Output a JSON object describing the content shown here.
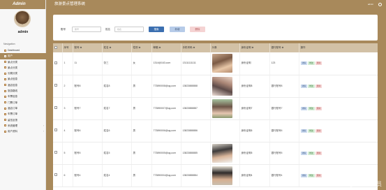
{
  "app": {
    "brand": "Admin",
    "title": "旅游景点管理系统",
    "user_top": "admin",
    "sidebar_user": "admin"
  },
  "sidebar": {
    "section_title": "Navigation",
    "items": [
      {
        "label": "Dashboard",
        "active": false
      },
      {
        "label": "用户",
        "active": true
      },
      {
        "label": "景点分类",
        "active": false
      },
      {
        "label": "景点分类",
        "active": false
      },
      {
        "label": "长期分类",
        "active": false
      },
      {
        "label": "景点信息",
        "active": false
      },
      {
        "label": "酒店信息",
        "active": false
      },
      {
        "label": "旅游路线",
        "active": false
      },
      {
        "label": "车票信息",
        "active": false
      },
      {
        "label": "门票订单",
        "active": false
      },
      {
        "label": "酒店订单",
        "active": false
      },
      {
        "label": "车票订单",
        "active": false
      },
      {
        "label": "留言反馈",
        "active": false
      },
      {
        "label": "系统管理",
        "active": false,
        "chevron": true
      },
      {
        "label": "用户资料",
        "active": false,
        "chevron": true
      }
    ]
  },
  "search": {
    "account_label": "账号",
    "account_placeholder": "账号",
    "name_label": "姓名",
    "name_placeholder": "姓名",
    "search_button": "搜索",
    "add_button": "新增",
    "delete_button": "删除"
  },
  "table": {
    "headers": [
      "",
      "序号",
      "账号 ≑",
      "姓名 ≑",
      "性别 ≑",
      "邮箱 ≑",
      "手机号码 ≑",
      "头像",
      "身份证明 ≑",
      "银行账号 ≑",
      "操作"
    ],
    "actions": {
      "detail": "详情",
      "edit": "修改",
      "delete": "删除"
    },
    "rows": [
      {
        "idx": "1",
        "account": "11",
        "name": "张三",
        "gender": "女",
        "email": "1314@163.com",
        "phone": "13111111111",
        "photo": "ph-a",
        "id_card": "身份证明",
        "bank": "123"
      },
      {
        "idx": "2",
        "account": "账号8",
        "name": "姓名8",
        "gender": "男",
        "email": "773890008@qq.com",
        "phone": "13823888888",
        "photo": "ph-b",
        "id_card": "身份证明8",
        "bank": "银行账号8"
      },
      {
        "idx": "3",
        "account": "账号7",
        "name": "姓名7",
        "gender": "男",
        "email": "773890007@qq.com",
        "phone": "13823888887",
        "photo": "ph-c",
        "id_card": "身份证明7",
        "bank": "银行账号7"
      },
      {
        "idx": "4",
        "account": "账号6",
        "name": "姓名6",
        "gender": "男",
        "email": "773890006@qq.com",
        "phone": "13823888886",
        "photo": "",
        "id_card": "身份证明6",
        "bank": "银行账号6"
      },
      {
        "idx": "5",
        "account": "账号5",
        "name": "姓名5",
        "gender": "男",
        "email": "773890005@qq.com",
        "phone": "13823888885",
        "photo": "ph-d",
        "id_card": "身份证明5",
        "bank": "银行账号5"
      },
      {
        "idx": "6",
        "account": "账号4",
        "name": "姓名4",
        "gender": "男",
        "email": "773890004@qq.com",
        "phone": "13823888884",
        "photo": "ph-e",
        "id_card": "身份证明4",
        "bank": "银行账号4"
      }
    ]
  },
  "watermark": "CSDN @黑马程序员"
}
